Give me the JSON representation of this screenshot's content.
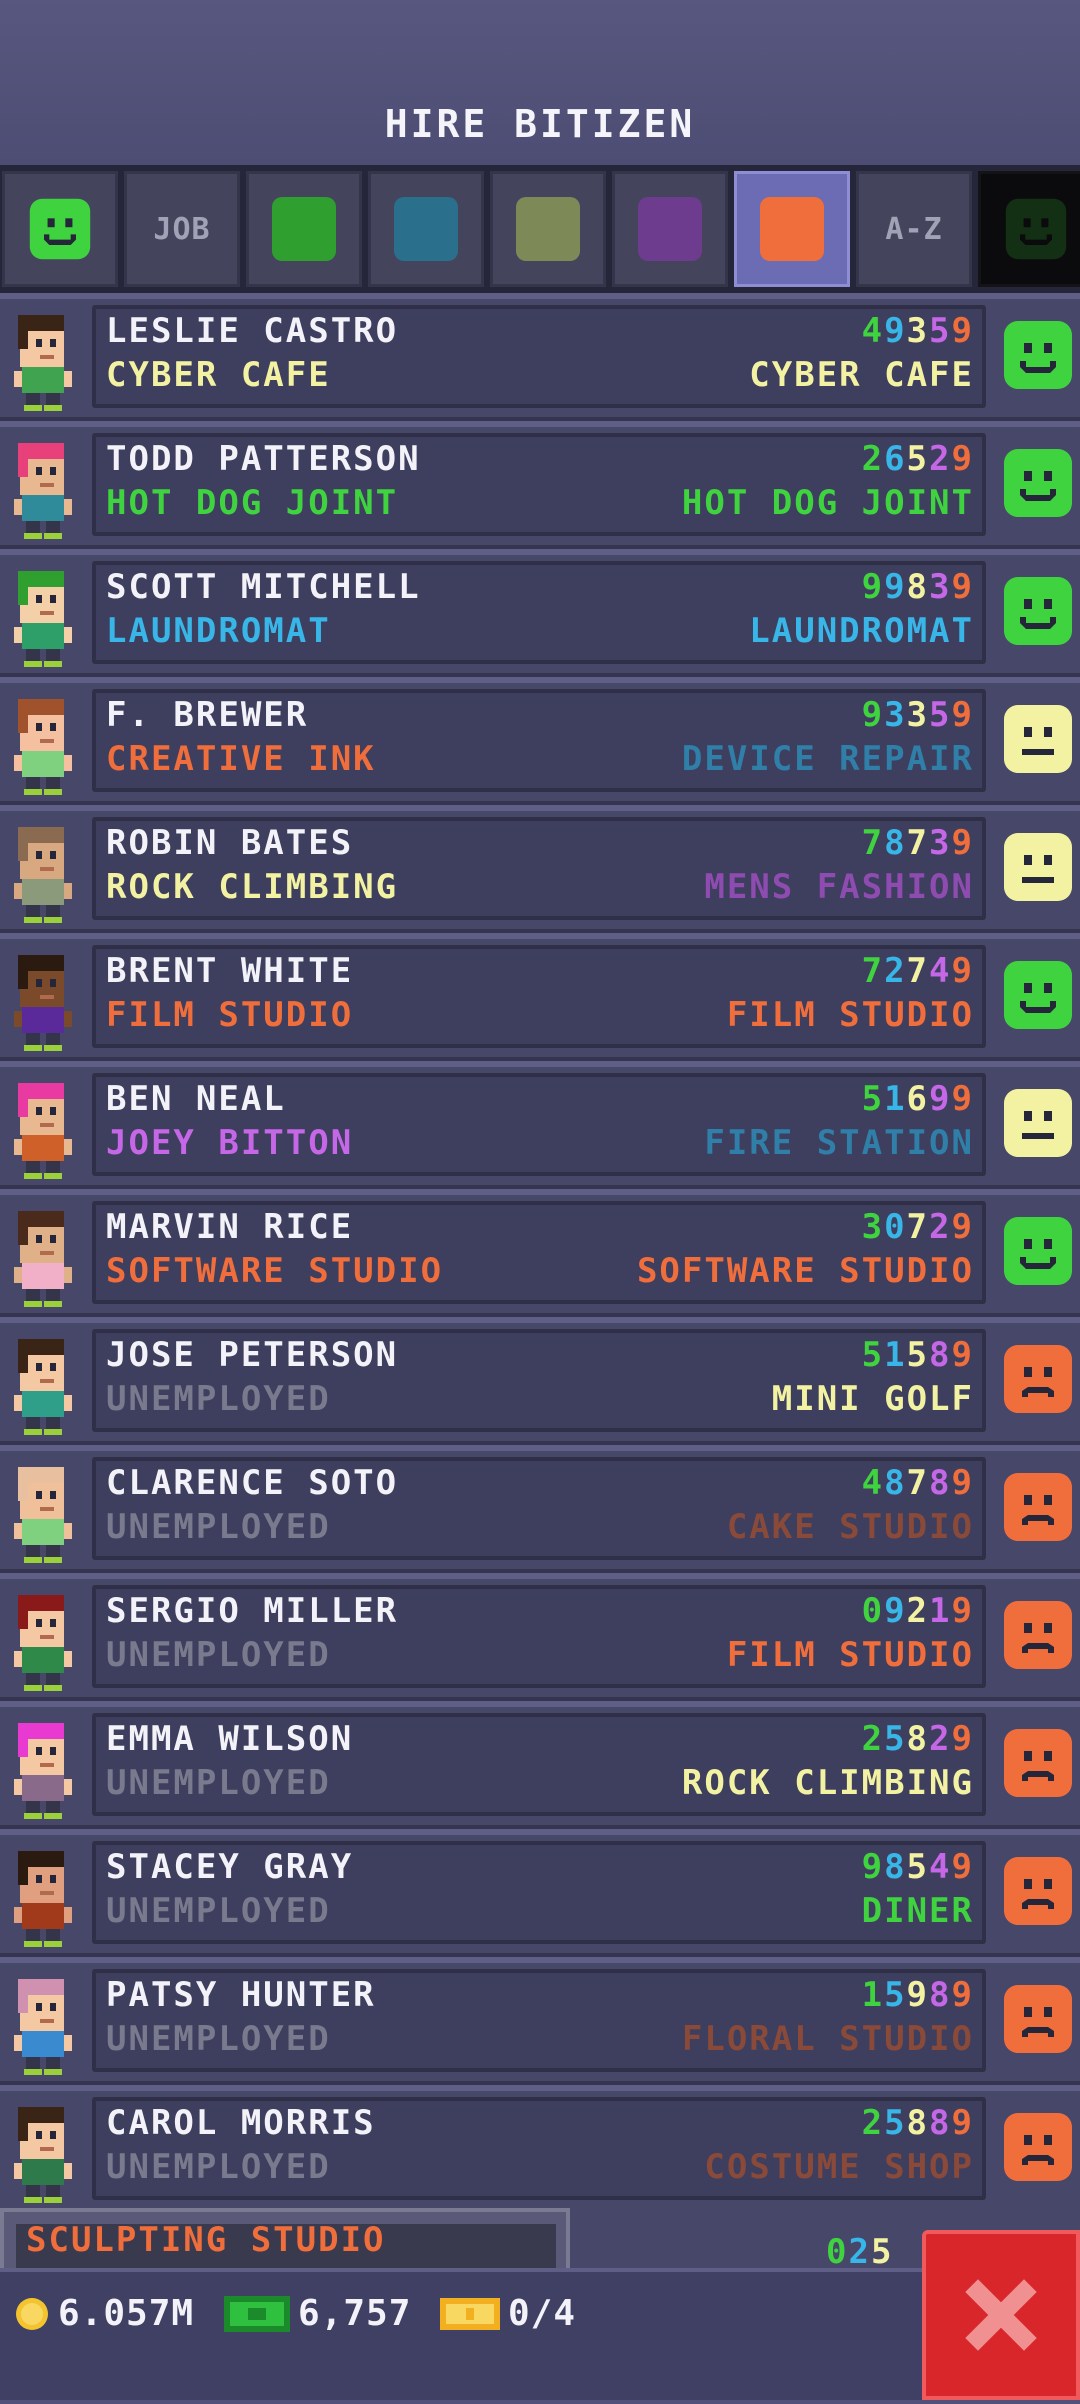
{
  "title": "HIRE BITIZEN",
  "colors": {
    "happy": "#3fd33f",
    "neutral": "#f2f2a2",
    "sad": "#f06e3c",
    "stat_colors": [
      "#3fd33f",
      "#38b6e8",
      "#f2f2a2",
      "#c567e6",
      "#f06e3c"
    ]
  },
  "filters": {
    "tabs": [
      {
        "type": "icon",
        "icon": "happy-face-icon",
        "color": "#3fd33f"
      },
      {
        "type": "text",
        "label": "JOB"
      },
      {
        "type": "swatch",
        "icon": "green-category-icon",
        "color": "#2f9f2f"
      },
      {
        "type": "swatch",
        "icon": "blue-category-icon",
        "color": "#2a6f8c"
      },
      {
        "type": "swatch",
        "icon": "olive-category-icon",
        "color": "#7d8a58"
      },
      {
        "type": "swatch",
        "icon": "purple-category-icon",
        "color": "#6e3c8e"
      },
      {
        "type": "swatch",
        "icon": "orange-category-icon",
        "color": "#f06e3c",
        "active": true
      },
      {
        "type": "text",
        "label": "A-Z"
      },
      {
        "type": "icon",
        "icon": "dark-face-icon",
        "color": "#143014",
        "dark": true
      }
    ]
  },
  "residents": [
    {
      "name": "LESLIE CASTRO",
      "current": "CYBER CAFE",
      "current_color": "#f2f2a2",
      "stats": "49359",
      "dream": "CYBER CAFE",
      "dream_color": "#f2f2a2",
      "mood": "happy",
      "hair": "#3a2416",
      "skin": "#f4c8a2",
      "shirt": "#3fa34f"
    },
    {
      "name": "TODD PATTERSON",
      "current": "HOT DOG JOINT",
      "current_color": "#3fd33f",
      "stats": "26529",
      "dream": "HOT DOG JOINT",
      "dream_color": "#3fd33f",
      "mood": "happy",
      "hair": "#e8407a",
      "skin": "#e8b890",
      "shirt": "#2f8a9a"
    },
    {
      "name": "SCOTT MITCHELL",
      "current": "LAUNDROMAT",
      "current_color": "#38b6e8",
      "stats": "99839",
      "dream": "LAUNDROMAT",
      "dream_color": "#38b6e8",
      "mood": "happy",
      "hair": "#2fa02f",
      "skin": "#f4d0a8",
      "shirt": "#2f9f6a"
    },
    {
      "name": "F. BREWER",
      "current": "CREATIVE INK",
      "current_color": "#f06e3c",
      "stats": "93359",
      "dream": "DEVICE REPAIR",
      "dream_color": "#2f7fa8",
      "mood": "neutral",
      "hair": "#a0522d",
      "skin": "#f4c0a0",
      "shirt": "#7fd07f"
    },
    {
      "name": "ROBIN BATES",
      "current": "ROCK CLIMBING",
      "current_color": "#f2f2a2",
      "stats": "78739",
      "dream": "MENS FASHION",
      "dream_color": "#8e4cb0",
      "mood": "neutral",
      "hair": "#8a6a50",
      "skin": "#d8a880",
      "shirt": "#8a9a7a"
    },
    {
      "name": "BRENT WHITE",
      "current": "FILM STUDIO",
      "current_color": "#f06e3c",
      "stats": "72749",
      "dream": "FILM STUDIO",
      "dream_color": "#f06e3c",
      "mood": "happy",
      "hair": "#2a1a10",
      "skin": "#7a4a2a",
      "shirt": "#5a2a9a"
    },
    {
      "name": "BEN NEAL",
      "current": "JOEY BITTON",
      "current_color": "#c567e6",
      "stats": "51699",
      "dream": "FIRE STATION",
      "dream_color": "#2f7fa8",
      "mood": "neutral",
      "hair": "#e83aa0",
      "skin": "#e8b890",
      "shirt": "#d0602a"
    },
    {
      "name": "MARVIN RICE",
      "current": "SOFTWARE STUDIO",
      "current_color": "#f06e3c",
      "stats": "30729",
      "dream": "SOFTWARE STUDIO",
      "dream_color": "#f06e3c",
      "mood": "happy",
      "hair": "#4a2a1a",
      "skin": "#e0b088",
      "shirt": "#f2b0c8"
    },
    {
      "name": "JOSE PETERSON",
      "current": "UNEMPLOYED",
      "current_color": "#7a7a8e",
      "stats": "51589",
      "dream": "MINI GOLF",
      "dream_color": "#f2f2a2",
      "mood": "sad",
      "hair": "#3a2416",
      "skin": "#f4c8a2",
      "shirt": "#2f9f8a"
    },
    {
      "name": "CLARENCE SOTO",
      "current": "UNEMPLOYED",
      "current_color": "#7a7a8e",
      "stats": "48789",
      "dream": "CAKE STUDIO",
      "dream_color": "#8a4a3a",
      "mood": "sad",
      "hair": "#e8c0a0",
      "skin": "#f0c09a",
      "shirt": "#7fd07f"
    },
    {
      "name": "SERGIO MILLER",
      "current": "UNEMPLOYED",
      "current_color": "#7a7a8e",
      "stats": "09219",
      "dream": "FILM STUDIO",
      "dream_color": "#f06e3c",
      "mood": "sad",
      "hair": "#8a1a1a",
      "skin": "#f4c8a2",
      "shirt": "#2f8a4a"
    },
    {
      "name": "EMMA WILSON",
      "current": "UNEMPLOYED",
      "current_color": "#7a7a8e",
      "stats": "25829",
      "dream": "ROCK CLIMBING",
      "dream_color": "#f2f2a2",
      "mood": "sad",
      "hair": "#e83ad0",
      "skin": "#f4c8a2",
      "shirt": "#8a6a8a"
    },
    {
      "name": "STACEY GRAY",
      "current": "UNEMPLOYED",
      "current_color": "#7a7a8e",
      "stats": "98549",
      "dream": "DINER",
      "dream_color": "#3fd33f",
      "mood": "sad",
      "hair": "#2a1a10",
      "skin": "#e0a080",
      "shirt": "#a03a1a"
    },
    {
      "name": "PATSY HUNTER",
      "current": "UNEMPLOYED",
      "current_color": "#7a7a8e",
      "stats": "15989",
      "dream": "FLORAL STUDIO",
      "dream_color": "#8a4a3a",
      "mood": "sad",
      "hair": "#d090b0",
      "skin": "#f4c8a2",
      "shirt": "#3a8ad0"
    },
    {
      "name": "CAROL MORRIS",
      "current": "UNEMPLOYED",
      "current_color": "#7a7a8e",
      "stats": "25889",
      "dream": "COSTUME SHOP",
      "dream_color": "#8a4a3a",
      "mood": "sad",
      "hair": "#3a2416",
      "skin": "#f4c8a2",
      "shirt": "#2f7a4a"
    }
  ],
  "partial_row": {
    "label": "SCULPTING STUDIO",
    "stats": "025"
  },
  "bottom": {
    "coins": "6.057M",
    "coins_icon": "coin-icon",
    "bux": "6,757",
    "bux_icon": "cash-icon",
    "tickets": "0/4",
    "tickets_icon": "ticket-icon",
    "close_icon": "close-icon"
  }
}
